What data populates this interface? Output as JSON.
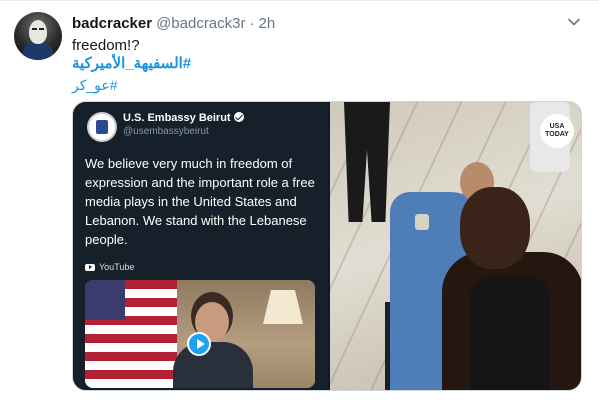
{
  "tweet": {
    "display_name": "badcracker",
    "handle": "@badcrack3r",
    "separator": "·",
    "time": "2h",
    "lines": [
      "freedom!?",
      "#السفيهة_الأميركية",
      "#عو_كر"
    ]
  },
  "embedded_tweet": {
    "name": "U.S. Embassy Beirut",
    "handle": "@usembassybeirut",
    "text": "We believe very much in freedom of expression and the important role a free media plays in the United States and Lebanon.  We stand with the Lebanese people.",
    "video_source": "YouTube"
  },
  "photo": {
    "watermark_line1": "USA",
    "watermark_line2": "TODAY"
  },
  "icons": {
    "more": "chevron-down-icon",
    "verified": "verified-badge-icon",
    "play": "play-icon",
    "youtube": "youtube-icon"
  },
  "colors": {
    "link": "#1b95e0",
    "muted": "#657786",
    "text": "#14171a",
    "embed_bg": "#15202b",
    "play": "#1da1f2"
  }
}
